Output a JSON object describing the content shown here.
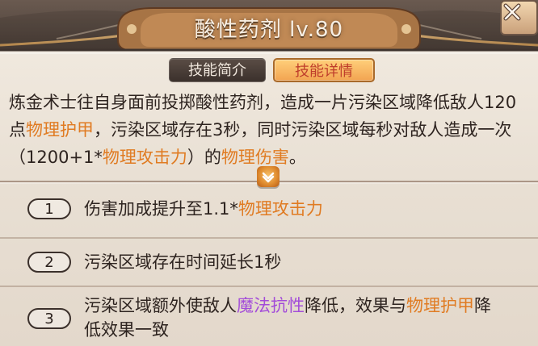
{
  "dialog": {
    "title": "酸性药剂 lv.80"
  },
  "tabs": [
    {
      "label": "技能简介",
      "active": false
    },
    {
      "label": "技能详情",
      "active": true
    }
  ],
  "description": {
    "segments": [
      {
        "text": "炼金术士往自身面前投掷酸性药剂，造成一片污染区域降低敌人120点",
        "style": "normal"
      },
      {
        "text": "物理护甲",
        "style": "orange"
      },
      {
        "text": "，污染区域存在3秒，同时污染区域每秒对敌人造成一次（1200+1*",
        "style": "normal"
      },
      {
        "text": "物理攻击力",
        "style": "orange"
      },
      {
        "text": "）的",
        "style": "normal"
      },
      {
        "text": "物理伤害",
        "style": "orange"
      },
      {
        "text": "。",
        "style": "normal"
      }
    ]
  },
  "upgrades": [
    {
      "number": "1",
      "segments": [
        {
          "text": "伤害加成提升至1.1*",
          "style": "normal"
        },
        {
          "text": "物理攻击力",
          "style": "orange"
        }
      ]
    },
    {
      "number": "2",
      "segments": [
        {
          "text": "污染区域存在时间延长1秒",
          "style": "normal"
        }
      ]
    },
    {
      "number": "3",
      "segments": [
        {
          "text": "污染区域额外使敌人",
          "style": "normal"
        },
        {
          "text": "魔法抗性",
          "style": "purple"
        },
        {
          "text": "降低，效果与",
          "style": "normal"
        },
        {
          "text": "物理护甲",
          "style": "orange"
        },
        {
          "text": "降低效果一致",
          "style": "normal"
        }
      ]
    }
  ],
  "icons": {
    "close": "close-icon",
    "expand": "chevron-down-icon"
  },
  "colors": {
    "highlight_orange": "#e07b22",
    "highlight_purple": "#a34cd9",
    "active_tab_text": "#bf3d2b"
  }
}
